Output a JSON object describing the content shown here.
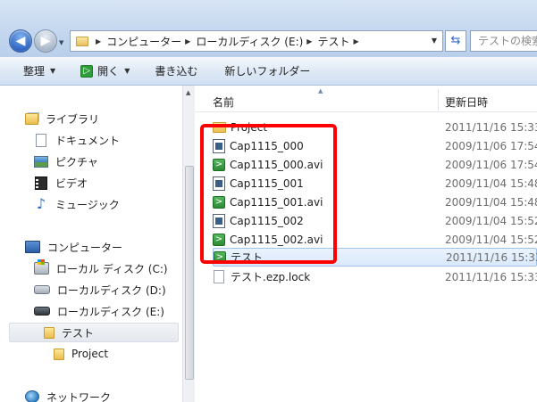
{
  "address": {
    "crumbs": [
      "コンピューター",
      "ローカルディスク (E:)",
      "テスト"
    ],
    "search_placeholder": "テストの検索"
  },
  "toolbar": {
    "organize": "整理",
    "open": "開く",
    "burn": "書き込む",
    "new_folder": "新しいフォルダー"
  },
  "nav": {
    "libraries": "ライブラリ",
    "documents": "ドキュメント",
    "pictures": "ピクチャ",
    "videos": "ビデオ",
    "music": "ミュージック",
    "computer": "コンピューター",
    "drive_c": "ローカル ディスク (C:)",
    "drive_d": "ローカルディスク (D:)",
    "drive_e": "ローカルディスク (E:)",
    "folder_test": "テスト",
    "folder_project": "Project",
    "network": "ネットワーク"
  },
  "columns": {
    "name": "名前",
    "modified": "更新日時"
  },
  "files": [
    {
      "name": "Project",
      "date": "2011/11/16 15:33"
    },
    {
      "name": "Cap1115_000",
      "date": "2009/11/06 17:54"
    },
    {
      "name": "Cap1115_000.avi",
      "date": "2009/11/06 17:54"
    },
    {
      "name": "Cap1115_001",
      "date": "2009/11/04 15:48"
    },
    {
      "name": "Cap1115_001.avi",
      "date": "2009/11/04 15:48"
    },
    {
      "name": "Cap1115_002",
      "date": "2009/11/04 15:52"
    },
    {
      "name": "Cap1115_002.avi",
      "date": "2009/11/04 15:52"
    },
    {
      "name": "テスト",
      "date": "2011/11/16 15:33"
    },
    {
      "name": "テスト.ezp.lock",
      "date": "2011/11/16 15:33"
    }
  ],
  "colors": {
    "highlight": "#ff0000",
    "selection": "#d9e9fb"
  }
}
